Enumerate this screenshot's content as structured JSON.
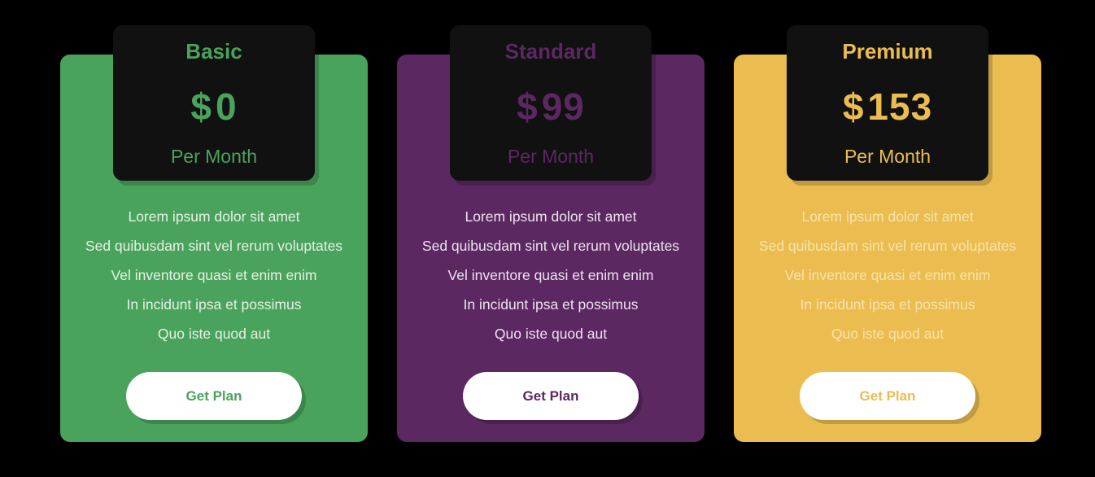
{
  "plans": [
    {
      "name": "Basic",
      "currency": "$",
      "price": "0",
      "period": "Per Month",
      "features": [
        "Lorem ipsum dolor sit amet",
        "Sed quibusdam sint vel rerum voluptates",
        "Vel inventore quasi et enim enim",
        "In incidunt ipsa et possimus",
        "Quo iste quod aut"
      ],
      "button_label": "Get Plan",
      "accent_color": "#4aa35c",
      "feature_text_color": "#e6f0e6"
    },
    {
      "name": "Standard",
      "currency": "$",
      "price": "99",
      "period": "Per Month",
      "features": [
        "Lorem ipsum dolor sit amet",
        "Sed quibusdam sint vel rerum voluptates",
        "Vel inventore quasi et enim enim",
        "In incidunt ipsa et possimus",
        "Quo iste quod aut"
      ],
      "button_label": "Get Plan",
      "accent_color": "#5b2861",
      "feature_text_color": "#ece4ee"
    },
    {
      "name": "Premium",
      "currency": "$",
      "price": "153",
      "period": "Per Month",
      "features": [
        "Lorem ipsum dolor sit amet",
        "Sed quibusdam sint vel rerum voluptates",
        "Vel inventore quasi et enim enim",
        "In incidunt ipsa et possimus",
        "Quo iste quod aut"
      ],
      "button_label": "Get Plan",
      "accent_color": "#ebbd50",
      "feature_text_color": "#f7e3ad"
    }
  ]
}
